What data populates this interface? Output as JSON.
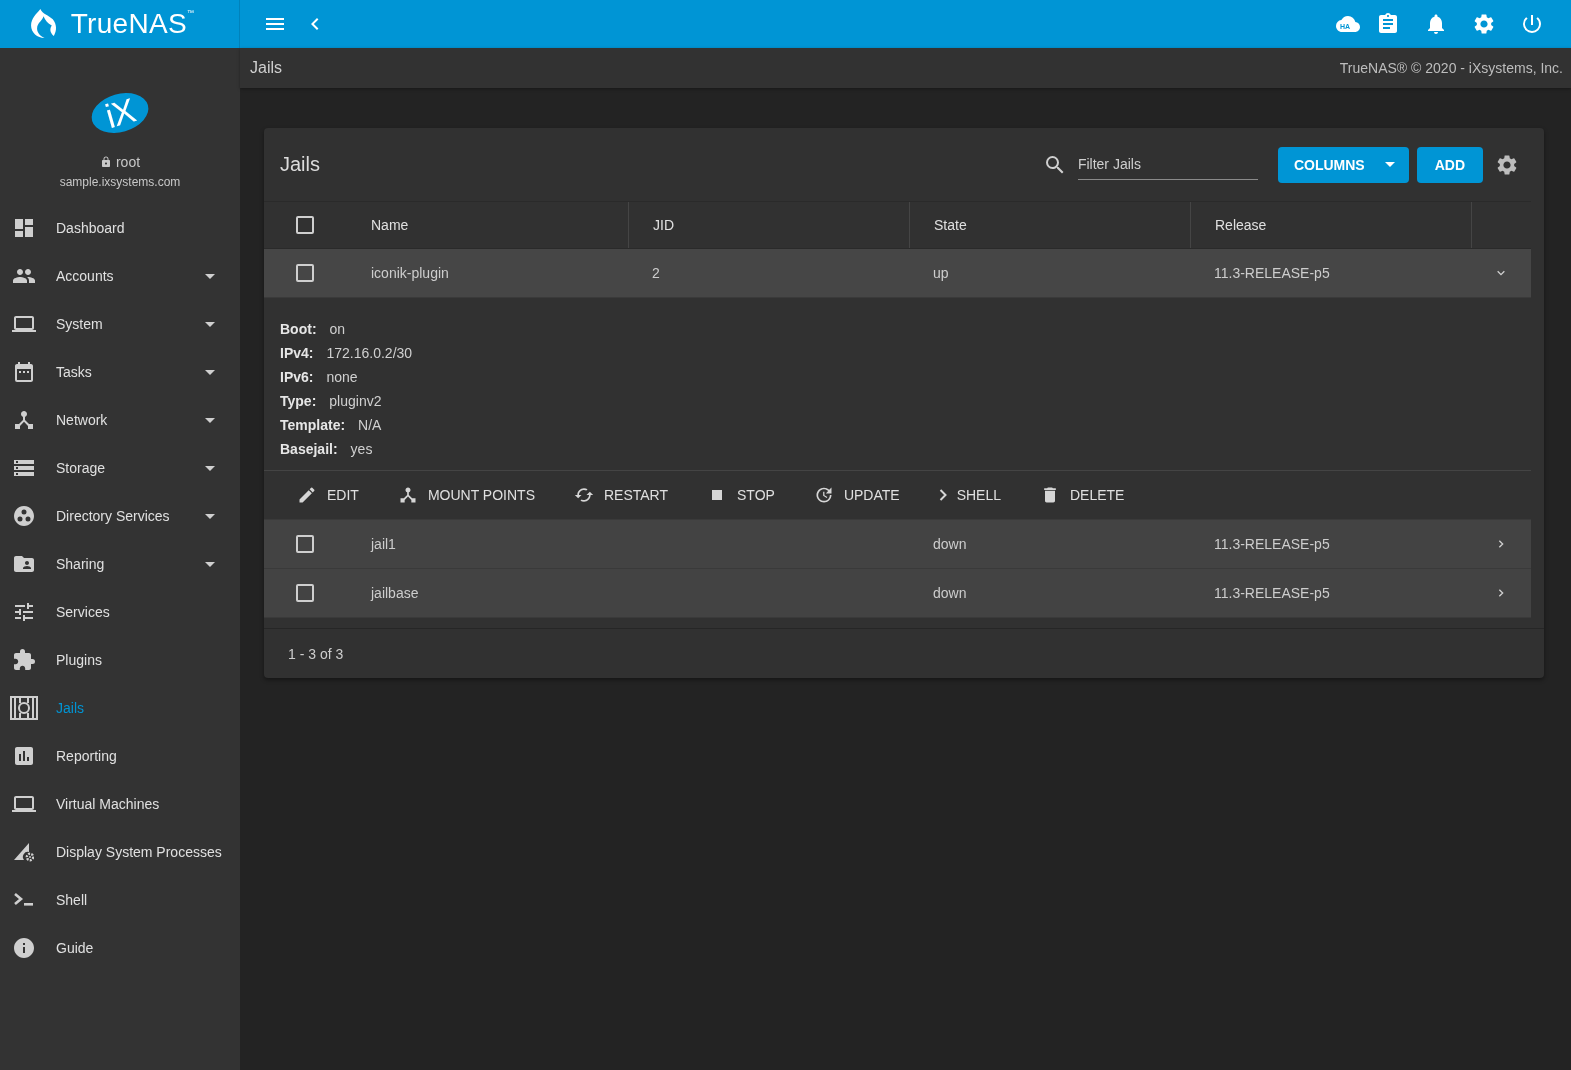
{
  "topbar": {
    "logo": "TrueNAS$^{™}$",
    "ha_badge": "HA"
  },
  "sidebar": {
    "logo": "iX",
    "user": "root",
    "hostname": "sample.ixsystems.com",
    "items": [
      {
        "label": "Dashboard",
        "expandable": false,
        "selected": false
      },
      {
        "label": "Accounts",
        "expandable": true,
        "selected": false
      },
      {
        "label": "System",
        "expandable": true,
        "selected": false
      },
      {
        "label": "Tasks",
        "expandable": true,
        "selected": false
      },
      {
        "label": "Network",
        "expandable": true,
        "selected": false
      },
      {
        "label": "Storage",
        "expandable": true,
        "selected": false
      },
      {
        "label": "Directory Services",
        "expandable": true,
        "selected": false
      },
      {
        "label": "Sharing",
        "expandable": true,
        "selected": false
      },
      {
        "label": "Services",
        "expandable": false,
        "selected": false
      },
      {
        "label": "Plugins",
        "expandable": false,
        "selected": false
      },
      {
        "label": "Jails",
        "expandable": false,
        "selected": true
      },
      {
        "label": "Reporting",
        "expandable": false,
        "selected": false
      },
      {
        "label": "Virtual Machines",
        "expandable": false,
        "selected": false
      },
      {
        "label": "Display System Processes",
        "expandable": false,
        "selected": false
      },
      {
        "label": "Shell",
        "expandable": false,
        "selected": false
      },
      {
        "label": "Guide",
        "expandable": false,
        "selected": false
      }
    ]
  },
  "breadcrumb": {
    "title": "Jails",
    "copyright": "TrueNAS® © 2020 - iXsystems, Inc."
  },
  "card": {
    "title": "Jails",
    "search": {
      "placeholder": "Filter Jails"
    },
    "buttons": [
      {
        "label": "COLUMNS",
        "kind": "dropdown"
      },
      {
        "label": "ADD",
        "kind": "plain"
      }
    ],
    "table": {
      "all_checked": false,
      "columns": [
        "Name",
        "JID",
        "State",
        "Release"
      ],
      "rows": [
        {
          "checked": false,
          "expanded": true,
          "name": "iconik-plugin",
          "jid": "2",
          "state": "up",
          "release": "11.3-RELEASE-p5",
          "details": [
            {
              "label": "Boot:",
              "value": "on"
            },
            {
              "label": "IPv4:",
              "value": "172.16.0.2/30"
            },
            {
              "label": "IPv6:",
              "value": "none"
            },
            {
              "label": "Type:",
              "value": "pluginv2"
            },
            {
              "label": "Template:",
              "value": "N/A"
            },
            {
              "label": "Basejail:",
              "value": "yes"
            }
          ],
          "actions": [
            "EDIT",
            "MOUNT POINTS",
            "RESTART",
            "STOP",
            "UPDATE",
            "SHELL",
            "DELETE"
          ]
        },
        {
          "checked": false,
          "expanded": false,
          "name": "jail1",
          "state": "down",
          "release": "11.3-RELEASE-p5"
        },
        {
          "checked": false,
          "expanded": false,
          "name": "jailbase",
          "state": "down",
          "release": "11.3-RELEASE-p5"
        }
      ]
    },
    "paginator": "1 - 3 of 3"
  }
}
